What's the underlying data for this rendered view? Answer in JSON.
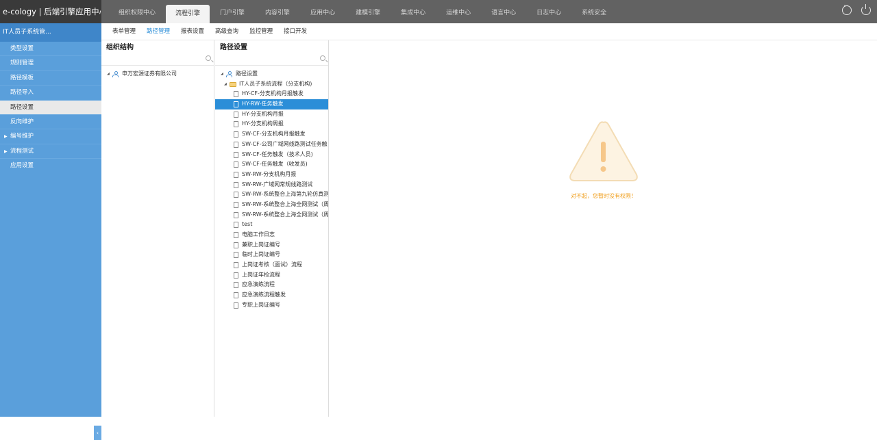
{
  "app": {
    "title": "e-cology | 后端引擎应用中心"
  },
  "main_tabs": [
    {
      "label": "组织权限中心",
      "active": false
    },
    {
      "label": "流程引擎",
      "active": true
    },
    {
      "label": "门户引擎",
      "active": false
    },
    {
      "label": "内容引擎",
      "active": false
    },
    {
      "label": "应用中心",
      "active": false
    },
    {
      "label": "建模引擎",
      "active": false
    },
    {
      "label": "集成中心",
      "active": false
    },
    {
      "label": "运维中心",
      "active": false
    },
    {
      "label": "语言中心",
      "active": false
    },
    {
      "label": "日志中心",
      "active": false
    },
    {
      "label": "系统安全",
      "active": false
    }
  ],
  "sidebar": {
    "header": "IT人员子系统管...",
    "items": [
      {
        "label": "类型设置"
      },
      {
        "label": "规则管理"
      },
      {
        "label": "路径模板"
      },
      {
        "label": "路径导入"
      },
      {
        "label": "路径设置",
        "active": true
      },
      {
        "label": "反向维护"
      },
      {
        "label": "编号维护",
        "expandable": true
      },
      {
        "label": "流程测试",
        "expandable": true
      },
      {
        "label": "应用设置"
      }
    ],
    "collapse_glyph": "‹"
  },
  "sub_tabs": [
    {
      "label": "表单管理",
      "active": false
    },
    {
      "label": "路径管理",
      "active": true
    },
    {
      "label": "报表设置",
      "active": false
    },
    {
      "label": "高级查询",
      "active": false
    },
    {
      "label": "监控管理",
      "active": false
    },
    {
      "label": "接口开发",
      "active": false
    }
  ],
  "org_panel": {
    "title": "组织结构",
    "search_placeholder": "",
    "root": "申万宏源证券有限公司"
  },
  "path_panel": {
    "title": "路径设置",
    "search_placeholder": "",
    "root": "路径设置",
    "folder": "IT人员子系统流程（分支机构)",
    "files": [
      "HY-CF-分支机构月报触发",
      "HY-RW-任务触发",
      "HY-分支机构月报",
      "HY-分支机构周报",
      "SW-CF-分支机构月报触发",
      "SW-CF-公司广域网线路测试任务触",
      "SW-CF-任务触发（技术人员)",
      "SW-CF-任务触发（收发员)",
      "SW-RW-分支机构月报",
      "SW-RW-广域网常规线路测试",
      "SW-RW-系统整合上海第九轮仿真测",
      "SW-RW-系统整合上海全网测试（周",
      "SW-RW-系统整合上海全网测试（周",
      "test",
      "电脑工作日志",
      "兼职上岗证编号",
      "临时上岗证编号",
      "上岗证考核（面试）流程",
      "上岗证年检流程",
      "应急演练流程",
      "应急演练流程触发",
      "专职上岗证编号"
    ],
    "selected_index": 1
  },
  "message": {
    "text": "对不起，您暂时没有权限！",
    "icon": "warning-triangle-icon",
    "color": "#f0a020"
  },
  "colors": {
    "topbar": "#626262",
    "sidebar": "#5a9fdb",
    "accent": "#2b8ed8"
  }
}
